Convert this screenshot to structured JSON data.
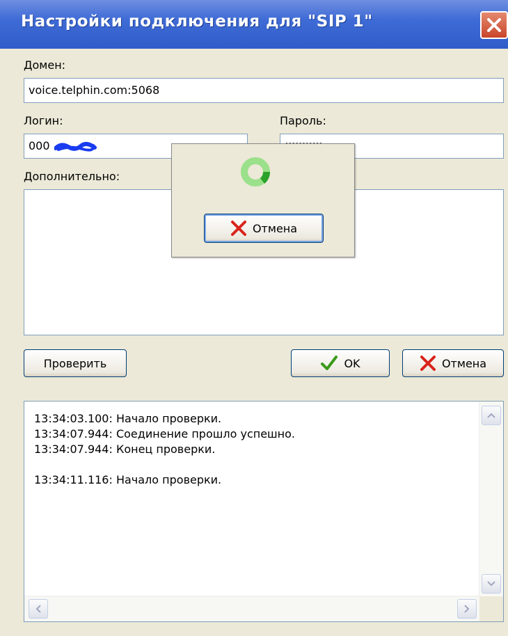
{
  "window": {
    "title": "Настройки подключения для \"SIP 1\"",
    "title_bar_color": "#3f6bd6",
    "close_icon": "close-icon"
  },
  "form": {
    "domain_label": "Домен:",
    "domain_value": "voice.telphin.com:5068",
    "login_label": "Логин:",
    "login_value_prefix": "000",
    "password_label": "Пароль:",
    "password_value": "•••••••••••",
    "extra_label": "Дополнительно:",
    "extra_value": ""
  },
  "buttons": {
    "check_label": "Проверить",
    "ok_label": "OK",
    "cancel_label": "Отмена"
  },
  "popup": {
    "spinner_icon": "loading-spinner-icon",
    "cancel_label": "Отмена"
  },
  "log": {
    "lines": [
      "13:34:03.100: Начало проверки.",
      "13:34:07.944: Соединение прошло успешно.",
      "13:34:07.944: Конец проверки.",
      "",
      "13:34:11.116: Начало проверки."
    ]
  },
  "colors": {
    "ok_check": "#3a9a1a",
    "cancel_x": "#d8231b",
    "spinner_light": "#9be08a",
    "spinner_dark": "#2aa12a"
  }
}
